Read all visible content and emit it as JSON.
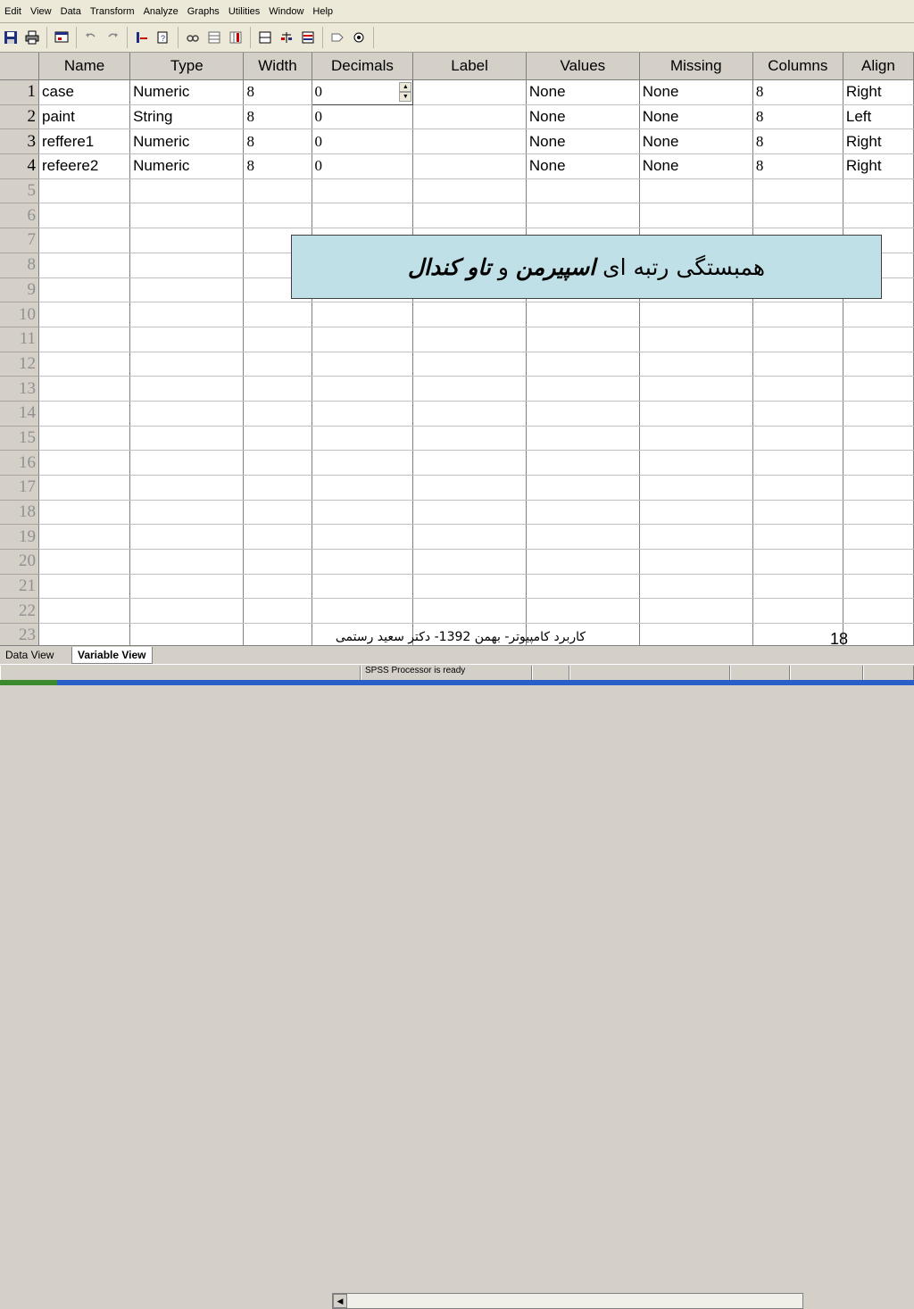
{
  "menu": [
    "Edit",
    "View",
    "Data",
    "Transform",
    "Analyze",
    "Graphs",
    "Utilities",
    "Window",
    "Help"
  ],
  "toolbar_icons": [
    "save-icon",
    "print-icon",
    "dialog-recall-icon",
    "undo-icon",
    "redo-icon",
    "goto-case-icon",
    "variables-icon",
    "find-icon",
    "insert-cases-icon",
    "insert-variable-icon",
    "split-file-icon",
    "weight-cases-icon",
    "select-cases-icon",
    "value-labels-icon",
    "use-sets-icon"
  ],
  "columns": [
    "Name",
    "Type",
    "Width",
    "Decimals",
    "Label",
    "Values",
    "Missing",
    "Columns",
    "Align"
  ],
  "rows": [
    {
      "num": "1",
      "name": "case",
      "type": "Numeric",
      "width": "8",
      "decimals": "0",
      "label": "",
      "values": "None",
      "missing": "None",
      "columns": "8",
      "align": "Right"
    },
    {
      "num": "2",
      "name": "paint",
      "type": "String",
      "width": "8",
      "decimals": "0",
      "label": "",
      "values": "None",
      "missing": "None",
      "columns": "8",
      "align": "Left"
    },
    {
      "num": "3",
      "name": "reffere1",
      "type": "Numeric",
      "width": "8",
      "decimals": "0",
      "label": "",
      "values": "None",
      "missing": "None",
      "columns": "8",
      "align": "Right"
    },
    {
      "num": "4",
      "name": "refeere2",
      "type": "Numeric",
      "width": "8",
      "decimals": "0",
      "label": "",
      "values": "None",
      "missing": "None",
      "columns": "8",
      "align": "Right"
    }
  ],
  "empty_rows": [
    "5",
    "6",
    "7",
    "8",
    "9",
    "10",
    "11",
    "12",
    "13",
    "14",
    "15",
    "16",
    "17",
    "18",
    "19",
    "20",
    "21",
    "22",
    "23"
  ],
  "overlay": {
    "text_1": "همبستگی رتبه ای",
    "text_bold_1": "اسپیرمن",
    "text_2": "و",
    "text_bold_2": "تاو کندال"
  },
  "footer": {
    "text": "کاربرد کامپیوتر- بهمن 1392- دکتر سعید رستمی",
    "page": "18"
  },
  "tabs": {
    "data_view": "Data View",
    "variable_view": "Variable View"
  },
  "status": {
    "processor": "SPSS Processor  is ready"
  }
}
